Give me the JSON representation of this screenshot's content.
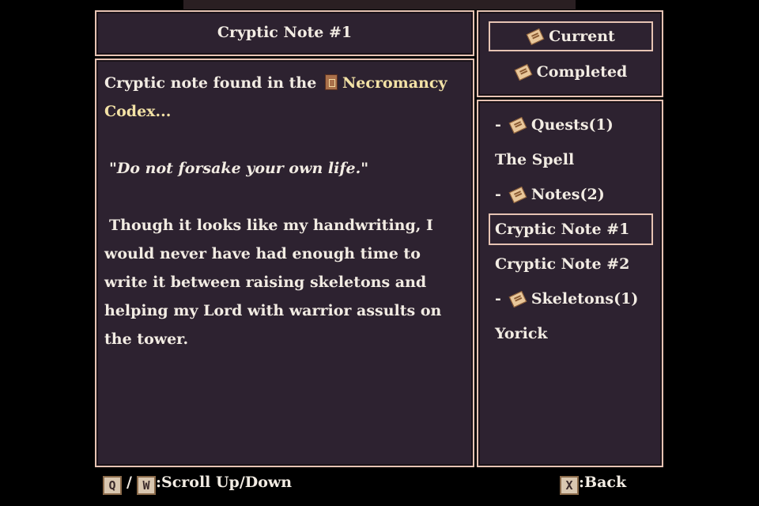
{
  "note": {
    "title": "Cryptic Note #1",
    "intro": "Cryptic note found in the",
    "item_name": "Necromancy",
    "item_name_cont": "Codex...",
    "quote_open": "\"",
    "quote": "Do not forsake your own life.",
    "quote_close": "\"",
    "body": "Though it looks like my handwriting, I would never have had enough time to write it between raising skeletons and helping my Lord with warrior assults on the tower."
  },
  "tabs": [
    {
      "label": "Current",
      "icon": "scroll-icon",
      "selected": true
    },
    {
      "label": "Completed",
      "icon": "scroll-icon",
      "selected": false
    }
  ],
  "list": {
    "categories": [
      {
        "dash": "-",
        "label": "Quests(1)",
        "icon": "scroll-icon"
      },
      {
        "dash": "-",
        "label": "Notes(2)",
        "icon": "scroll-icon"
      },
      {
        "dash": "-",
        "label": "Skeletons(1)",
        "icon": "scroll-icon"
      }
    ],
    "entries": [
      {
        "label": "The Spell"
      },
      {
        "label": "Cryptic Note #1",
        "selected": true
      },
      {
        "label": "Cryptic Note #2"
      },
      {
        "label": "Yorick"
      }
    ]
  },
  "footer": {
    "key_up": "Q",
    "slash": "/",
    "key_down": "W",
    "scroll_label": ":Scroll Up/Down",
    "key_back": "X",
    "back_label": ":Back"
  },
  "colors": {
    "panel_bg": "#2d2230",
    "border": "#e6c3b3",
    "text": "#f2ece3",
    "highlight": "#f3e2a6"
  }
}
